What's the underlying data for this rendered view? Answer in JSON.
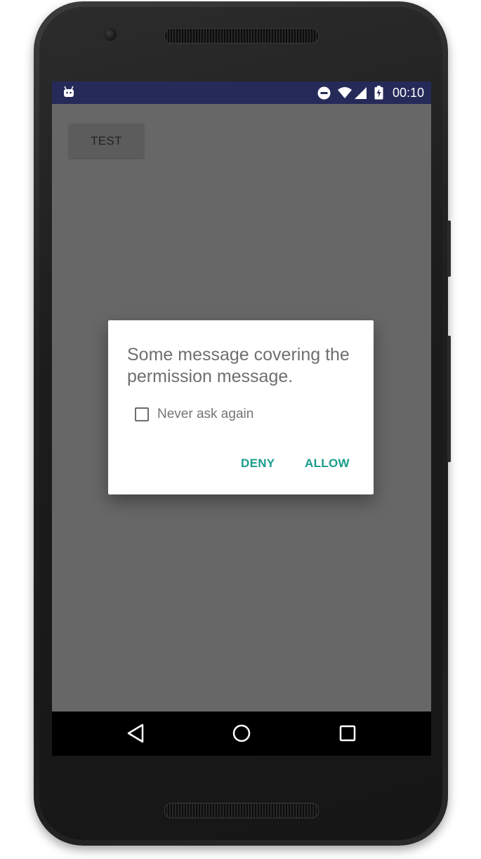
{
  "status_bar": {
    "time": "00:10",
    "icons": [
      "android-debug-icon",
      "do-not-disturb-icon",
      "wifi-icon",
      "cell-signal-icon",
      "battery-charging-icon"
    ],
    "background": "#262a59"
  },
  "app": {
    "test_button_label": "TEST"
  },
  "dialog": {
    "message": "Some message covering the permission message.",
    "checkbox_label": "Never ask again",
    "checkbox_checked": false,
    "deny_label": "DENY",
    "allow_label": "ALLOW",
    "accent_color": "#1a9b8b"
  },
  "nav_bar": {
    "icons": [
      "back-icon",
      "home-icon",
      "recents-icon"
    ]
  }
}
